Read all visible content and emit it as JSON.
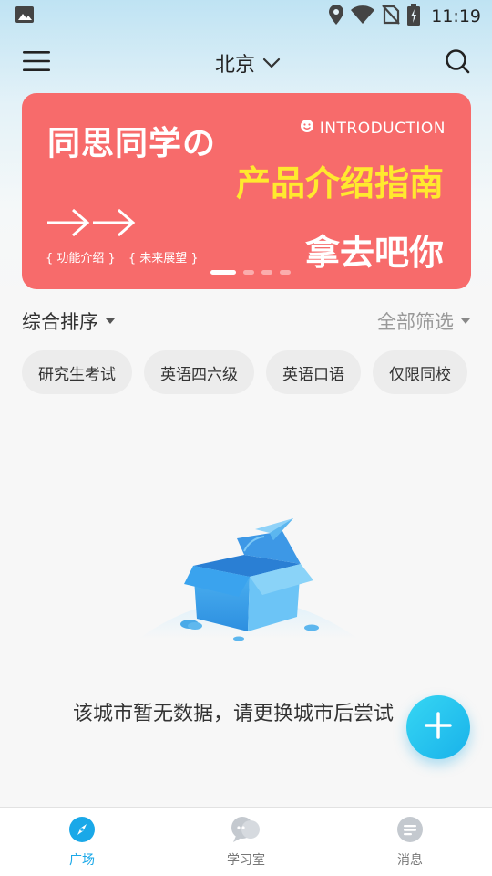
{
  "status_bar": {
    "time": "11:19"
  },
  "header": {
    "city": "北京"
  },
  "banner": {
    "title": "同思同学の",
    "intro": "INTRODUCTION",
    "subtitle": "产品介绍指南",
    "tags": [
      "{ 功能介绍 }",
      "{ 未来展望 }"
    ],
    "slogan": "拿去吧你",
    "dot_count": 4,
    "active_dot": 0
  },
  "sort": {
    "sort_label": "综合排序",
    "filter_label": "全部筛选"
  },
  "chips": [
    "研究生考试",
    "英语四六级",
    "英语口语",
    "仅限同校"
  ],
  "empty": {
    "message": "该城市暂无数据，请更换城市后尝试"
  },
  "nav": {
    "items": [
      {
        "label": "广场",
        "icon": "compass-icon",
        "active": true
      },
      {
        "label": "学习室",
        "icon": "chat-bubbles-icon",
        "active": false
      },
      {
        "label": "消息",
        "icon": "message-icon",
        "active": false
      }
    ]
  },
  "colors": {
    "banner_bg": "#f76b6b",
    "banner_highlight": "#ffe92e",
    "accent": "#1aa8e8"
  }
}
